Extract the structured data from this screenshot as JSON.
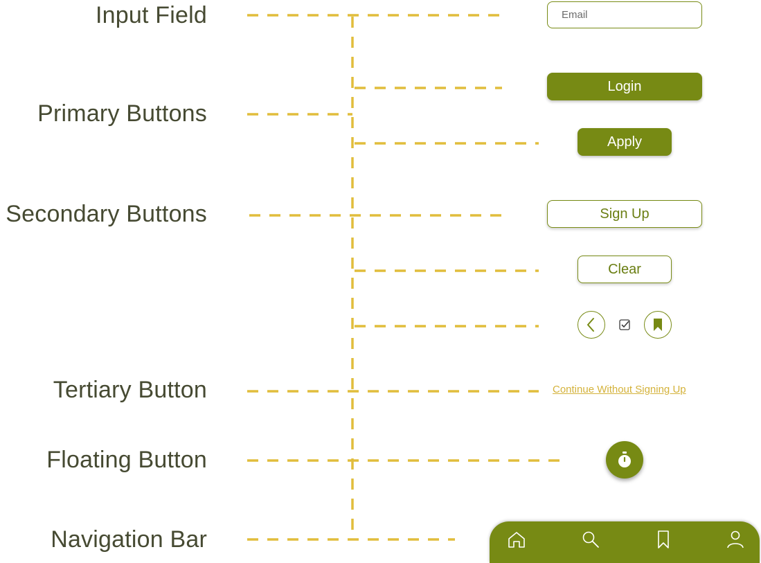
{
  "labels": {
    "input_field": "Input Field",
    "primary_buttons": "Primary Buttons",
    "secondary_buttons": "Secondary Buttons",
    "tertiary_button": "Tertiary Button",
    "floating_button": "Floating Button",
    "navigation_bar": "Navigation Bar"
  },
  "input": {
    "placeholder": "Email"
  },
  "primary": {
    "login": "Login",
    "apply": "Apply"
  },
  "secondary": {
    "sign_up": "Sign Up",
    "clear": "Clear"
  },
  "tertiary": {
    "continue": "Continue Without Signing Up"
  },
  "icons": {
    "back": "chevron-left-icon",
    "checkbox": "checkbox-icon",
    "bookmark": "bookmark-icon",
    "floating": "stopwatch-icon",
    "nav": [
      "home-icon",
      "search-icon",
      "bookmark-icon",
      "user-icon"
    ]
  },
  "colors": {
    "primary": "#778a14",
    "connector": "#e1bd3c",
    "label_text": "#464a32",
    "tertiary_text": "#d4b23a"
  }
}
